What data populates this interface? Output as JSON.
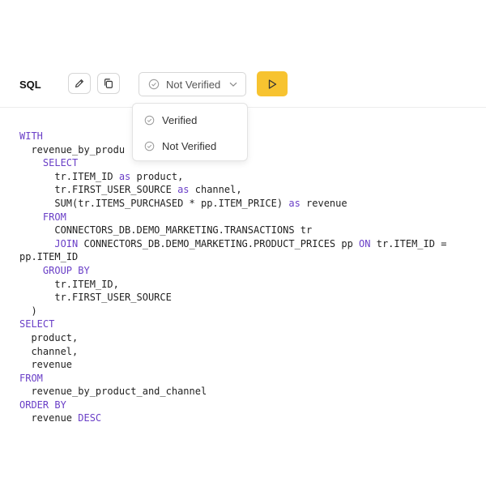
{
  "header": {
    "title": "SQL",
    "verify_select": {
      "value": "Not Verified"
    }
  },
  "dropdown": {
    "options": [
      "Verified",
      "Not Verified"
    ]
  },
  "colors": {
    "accent": "#f7c330",
    "keyword": "#6a3fc7"
  },
  "icons": {
    "edit": "pencil-icon",
    "copy": "copy-icon",
    "check": "check-circle-icon",
    "chevron": "chevron-down-icon",
    "run": "play-icon"
  },
  "code": [
    [
      {
        "k": true,
        "t": "WITH"
      }
    ],
    [
      {
        "t": "  revenue_by_produ"
      }
    ],
    [
      {
        "t": "    "
      },
      {
        "k": true,
        "t": "SELECT"
      }
    ],
    [
      {
        "t": "      tr.ITEM_ID "
      },
      {
        "k": true,
        "t": "as"
      },
      {
        "t": " product,"
      }
    ],
    [
      {
        "t": "      tr.FIRST_USER_SOURCE "
      },
      {
        "k": true,
        "t": "as"
      },
      {
        "t": " channel,"
      }
    ],
    [
      {
        "t": "      SUM(tr.ITEMS_PURCHASED * pp.ITEM_PRICE) "
      },
      {
        "k": true,
        "t": "as"
      },
      {
        "t": " revenue"
      }
    ],
    [
      {
        "t": "    "
      },
      {
        "k": true,
        "t": "FROM"
      }
    ],
    [
      {
        "t": "      CONNECTORS_DB.DEMO_MARKETING.TRANSACTIONS tr"
      }
    ],
    [
      {
        "t": "      "
      },
      {
        "k": true,
        "t": "JOIN"
      },
      {
        "t": " CONNECTORS_DB.DEMO_MARKETING.PRODUCT_PRICES pp "
      },
      {
        "k": true,
        "t": "ON"
      },
      {
        "t": " tr.ITEM_ID ="
      }
    ],
    [
      {
        "t": "pp.ITEM_ID"
      }
    ],
    [
      {
        "t": "    "
      },
      {
        "k": true,
        "t": "GROUP BY"
      }
    ],
    [
      {
        "t": "      tr.ITEM_ID,"
      }
    ],
    [
      {
        "t": "      tr.FIRST_USER_SOURCE"
      }
    ],
    [
      {
        "t": "  )"
      }
    ],
    [
      {
        "k": true,
        "t": "SELECT"
      }
    ],
    [
      {
        "t": "  product,"
      }
    ],
    [
      {
        "t": "  channel,"
      }
    ],
    [
      {
        "t": "  revenue"
      }
    ],
    [
      {
        "k": true,
        "t": "FROM"
      }
    ],
    [
      {
        "t": "  revenue_by_product_and_channel"
      }
    ],
    [
      {
        "k": true,
        "t": "ORDER BY"
      }
    ],
    [
      {
        "t": "  revenue "
      },
      {
        "k": true,
        "t": "DESC"
      }
    ]
  ]
}
